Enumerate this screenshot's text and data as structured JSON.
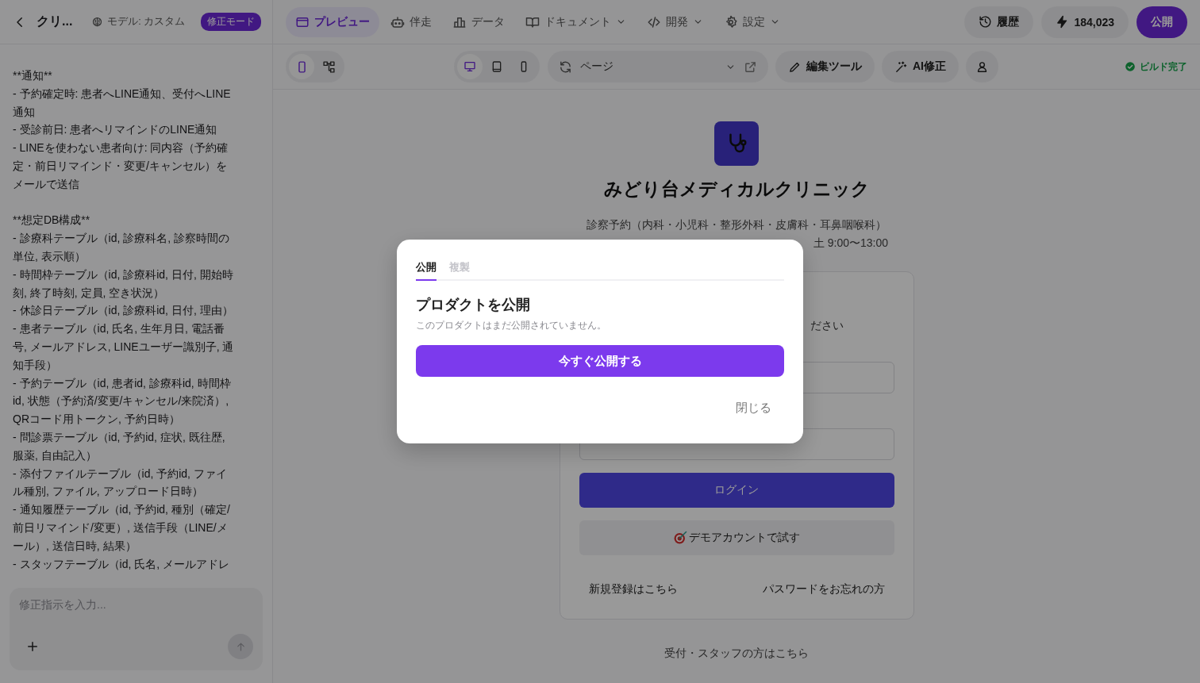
{
  "header": {
    "project_title": "クリ...",
    "model": "モデル: カスタム",
    "mode_badge": "修正モード"
  },
  "nav_tabs": [
    {
      "label": "プレビュー",
      "selected": true,
      "dropdown": false
    },
    {
      "label": "伴走",
      "selected": false,
      "dropdown": false
    },
    {
      "label": "データ",
      "selected": false,
      "dropdown": false
    },
    {
      "label": "ドキュメント",
      "selected": false,
      "dropdown": true
    },
    {
      "label": "開発",
      "selected": false,
      "dropdown": true
    },
    {
      "label": "設定",
      "selected": false,
      "dropdown": true
    }
  ],
  "header_actions": [
    {
      "kind": "history",
      "label": "履歴"
    },
    {
      "kind": "credits",
      "label": "184,023"
    },
    {
      "kind": "publish",
      "label": "公開"
    }
  ],
  "toolbar": {
    "view_modes": [
      {
        "selected": true
      },
      {
        "selected": false
      }
    ],
    "devices": [
      {
        "selected": true
      },
      {
        "selected": false
      },
      {
        "selected": false
      }
    ],
    "page_selector": {
      "value": "ページ"
    },
    "buttons": [
      {
        "kind": "edit",
        "label": "編集ツール"
      },
      {
        "kind": "ai",
        "label": "AI修正"
      },
      {
        "kind": "account"
      }
    ],
    "build_status": "ビルド完了"
  },
  "chat": {
    "sections": [
      {
        "lines": [
          "**通知**",
          "- 予約確定時: 患者へLINE通知、受付へLINE",
          "通知",
          "- 受診前日: 患者へリマインドのLINE通知",
          "- LINEを使わない患者向け: 同内容（予約確",
          "定・前日リマインド・変更/キャンセル）を",
          "メールで送信"
        ]
      },
      {
        "lines": [
          "**想定DB構成**",
          "- 診療科テーブル（id, 診療科名, 診察時間の",
          "単位, 表示順）",
          "- 時間枠テーブル（id, 診療科id, 日付, 開始時",
          "刻, 終了時刻, 定員, 空き状況）",
          "- 休診日テーブル（id, 診療科id, 日付, 理由）",
          "- 患者テーブル（id, 氏名, 生年月日, 電話番",
          "号, メールアドレス, LINEユーザー識別子, 通",
          "知手段）",
          "- 予約テーブル（id, 患者id, 診療科id, 時間枠",
          "id, 状態（予約済/変更/キャンセル/来院済）,",
          "QRコード用トークン, 予約日時）",
          "- 問診票テーブル（id, 予約id, 症状, 既往歴,",
          "服薬, 自由記入）",
          "- 添付ファイルテーブル（id, 予約id, ファイ",
          "ル種別, ファイル, アップロード日時）",
          "- 通知履歴テーブル（id, 予約id, 種別（確定/",
          "前日リマインド/変更）, 送信手段（LINE/メ",
          "ール）, 送信日時, 結果）",
          "- スタッフテーブル（id, 氏名, メールアドレ"
        ]
      }
    ],
    "input": {
      "placeholder": "修正指示を入力..."
    }
  },
  "preview": {
    "clinic_name": "みどり台メディカルクリニック",
    "subtitle_lines": [
      "診察予約（内科・小児科・整形外科・皮膚科・耳鼻咽喉科）",
      "土 9:00〜13:00"
    ],
    "card": {
      "visible_text": "ださい",
      "login_button": "ログイン",
      "demo_button": "デモアカウントで試す",
      "links": [
        "新規登録はこちら",
        "パスワードをお忘れの方"
      ]
    },
    "footer_link": "受付・スタッフの方はこちら"
  },
  "modal": {
    "tabs": [
      {
        "label": "公開",
        "selected": true
      },
      {
        "label": "複製",
        "selected": false
      }
    ],
    "title": "プロダクトを公開",
    "message": "このプロダクトはまだ公開されていません。",
    "primary_button": "今すぐ公開する",
    "close_button": "閉じる"
  }
}
